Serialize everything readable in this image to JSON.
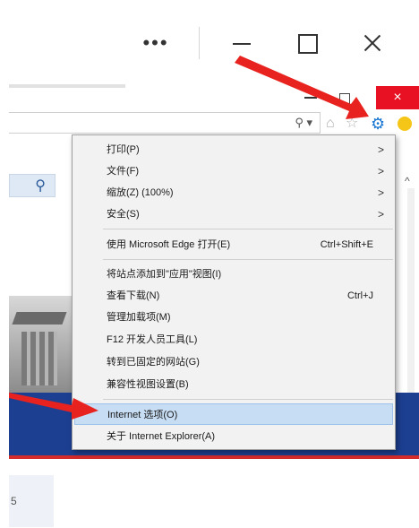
{
  "window": {
    "more_label": "•••",
    "ie_close_label": "×"
  },
  "toolbar": {
    "search_dropdown_label": "⚲ ▾"
  },
  "webpage": {
    "card_text": "5"
  },
  "tools_menu": {
    "items": [
      {
        "label": "打印(P)",
        "has_submenu": true
      },
      {
        "label": "文件(F)",
        "has_submenu": true
      },
      {
        "label": "缩放(Z) (100%)",
        "has_submenu": true
      },
      {
        "label": "安全(S)",
        "has_submenu": true
      },
      {
        "label": "使用 Microsoft Edge 打开(E)",
        "shortcut": "Ctrl+Shift+E"
      },
      {
        "label": "将站点添加到\"应用\"视图(I)"
      },
      {
        "label": "查看下载(N)",
        "shortcut": "Ctrl+J"
      },
      {
        "label": "管理加载项(M)"
      },
      {
        "label": "F12 开发人员工具(L)"
      },
      {
        "label": "转到已固定的网站(G)"
      },
      {
        "label": "兼容性视图设置(B)"
      },
      {
        "label": "Internet 选项(O)",
        "highlighted": true
      },
      {
        "label": "关于 Internet Explorer(A)"
      }
    ],
    "submenu_arrow": ">"
  },
  "colors": {
    "menu_highlight": "#c7ddf4",
    "ie_close_red": "#e81123",
    "annotation_red": "#e8231f",
    "page_band_blue": "#1d3f91",
    "gear_blue": "#1976d2"
  },
  "icons": [
    "more-icon",
    "minimize-icon",
    "maximize-icon",
    "close-icon",
    "search-icon",
    "home-icon",
    "favorites-star-icon",
    "gear-icon",
    "smiley-icon",
    "chevron-up-icon",
    "submenu-arrow-icon"
  ]
}
